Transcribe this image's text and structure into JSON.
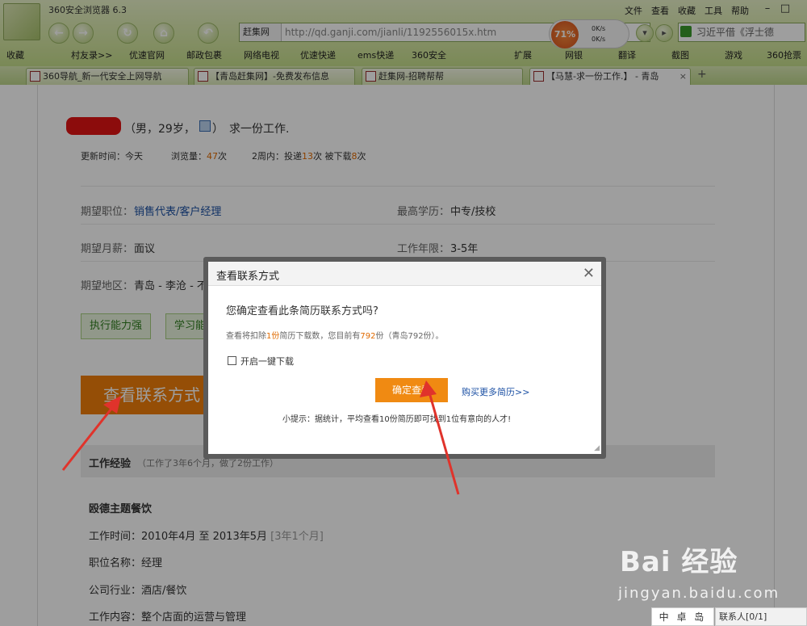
{
  "browser": {
    "app_title": "360安全浏览器 6.3",
    "menus": [
      "文件",
      "查看",
      "收藏",
      "工具",
      "帮助"
    ],
    "address_site": "赶集网",
    "address_url": "http://qd.ganji.com/jianli/1192556015x.htm",
    "speed_percent": "71%",
    "speed_up": "0K/s",
    "speed_down": "0K/s",
    "search_text": "习近平借《浮士德",
    "favorites": [
      "收藏",
      "村友录>>",
      "优速官网",
      "邮政包裹",
      "网络电视",
      "优速快递",
      "ems快递",
      "360安全",
      "扩展",
      "网银",
      "翻译",
      "截图",
      "游戏",
      "360抢票"
    ],
    "tabs": [
      "360导航_新一代安全上网导航",
      "【青岛赶集网】-免费发布信息",
      "赶集网-招聘帮帮",
      "【马慧-求一份工作.】 - 青岛"
    ]
  },
  "resume": {
    "title_suffix": "（男，29岁，",
    "title_tail": "）　求一份工作.",
    "updated": "更新时间：今天",
    "views_label": "浏览量：",
    "views": "47",
    "views_unit": "次",
    "week_label": "2周内：投递",
    "week_sent": "13",
    "week_mid": "次 被下载",
    "week_dl": "8",
    "week_unit": "次",
    "job_label": "期望职位：",
    "job_value": "销售代表/客户经理",
    "edu_label": "最高学历：",
    "edu_value": "中专/技校",
    "salary_label": "期望月薪：",
    "salary_value": "面议",
    "years_label": "工作年限：",
    "years_value": "3-5年",
    "area_label": "期望地区：",
    "area_value": "青岛 - 李沧 - 不限",
    "skills": [
      "执行能力强",
      "学习能力"
    ],
    "contact_button": "查看联系方式",
    "work_title": "工作经验",
    "work_sub": "（工作了3年6个月，做了2份工作）",
    "company": "殴德主题餐饮",
    "work_time_label": "工作时间：",
    "work_time": "2010年4月 至 2013年5月",
    "work_dur": "[3年1个月]",
    "position": "职位名称：经理",
    "industry": "公司行业：酒店/餐饮",
    "content": "工作内容：整个店面的运营与管理"
  },
  "dialog": {
    "title": "查看联系方式",
    "question": "您确定查看此条简历联系方式吗?",
    "info_a": "查看将扣除",
    "info_n1": "1份",
    "info_b": "简历下载数，您目前有",
    "info_n2": "792",
    "info_c": "份（青岛792份）。",
    "checkbox_label": "开启一键下载",
    "confirm": "确定查看",
    "buy_more": "购买更多简历>>",
    "tip": "小提示：据统计，平均查看10份简历即可找到1位有意向的人才!"
  },
  "footer": {
    "contacts": "联系人[0/1]",
    "badge": "中 卓 岛"
  },
  "watermark": {
    "main": "Bai 经验",
    "sub": "jingyan.baidu.com"
  },
  "colors": {
    "accent_orange": "#f08a12",
    "link_blue": "#1a4fa3",
    "arrow_red": "#e0332b",
    "highlight_orange": "#e06a00"
  }
}
